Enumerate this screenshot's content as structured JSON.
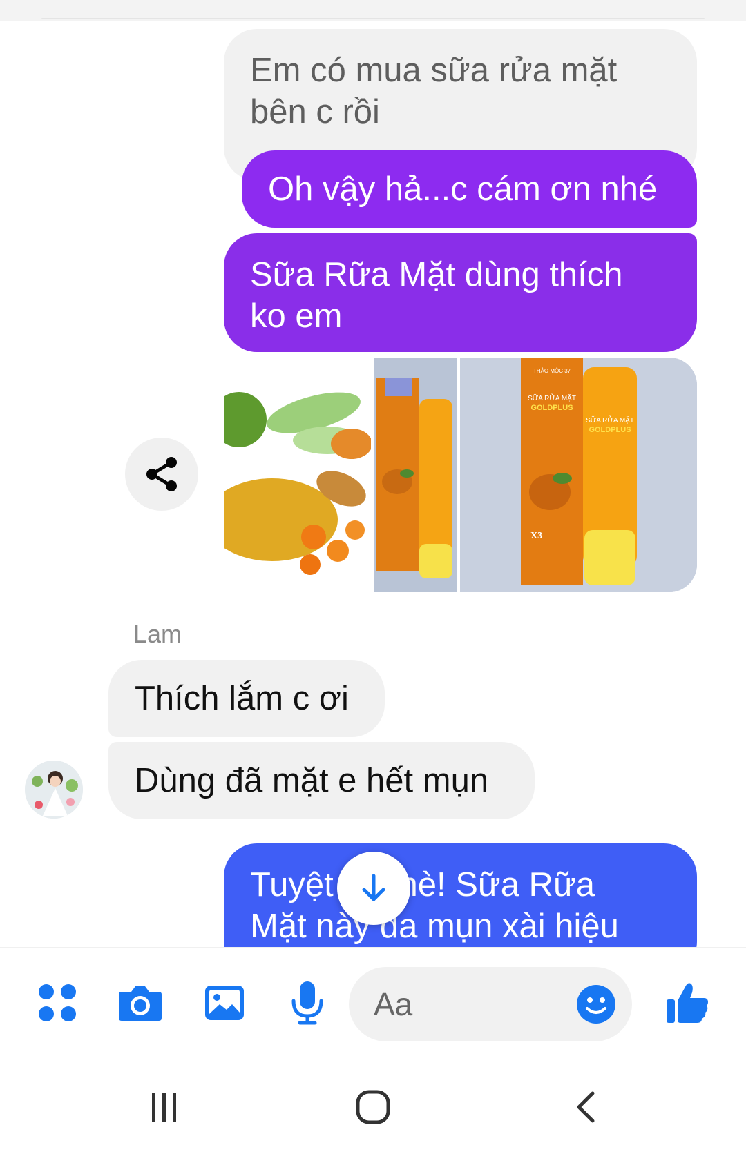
{
  "messages": {
    "outgoing_grey": "Em có mua sữa rửa mặt\nbên c rồi",
    "outgoing_purple_1": "Oh vậy hả...c cám ơn nhé",
    "outgoing_purple_2": "Sữa Rữa Mặt dùng thích\nko em",
    "sender_name": "Lam",
    "incoming_1": "Thích lắm c ơi",
    "incoming_2": "Dùng đã mặt e hết mụn",
    "outgoing_blue": "Tuyệt vời nè! Sữa Rữa\nMặt này da mụn xài hiệu"
  },
  "photos": {
    "product_line1": "SỮA RỬA MẶT",
    "product_line2": "GOLDPLUS",
    "badge": "X3",
    "brand": "THẢO MỘC 37"
  },
  "composer": {
    "placeholder": "Aa"
  },
  "colors": {
    "outgoing_purple": "#8d2bf0",
    "outgoing_blue": "#3f5ef6",
    "incoming_grey": "#f1f1f1",
    "icon_blue": "#1877f2"
  },
  "icons": [
    "share-icon",
    "menu-dots-icon",
    "camera-icon",
    "gallery-icon",
    "microphone-icon",
    "emoji-icon",
    "thumbs-up-icon",
    "arrow-down-icon",
    "recent-apps-icon",
    "home-icon",
    "back-icon"
  ]
}
